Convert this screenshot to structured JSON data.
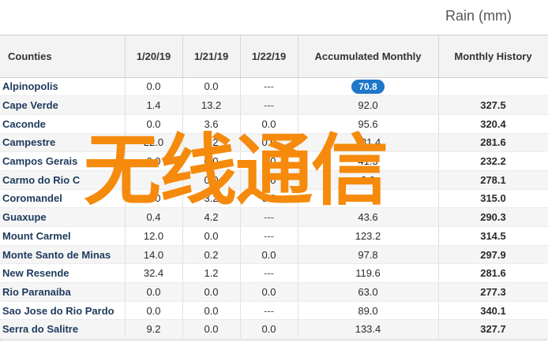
{
  "header": {
    "unit_label": "Rain (mm)"
  },
  "columns": {
    "county": "Counties",
    "d1": "1/20/19",
    "d2": "1/21/19",
    "d3": "1/22/19",
    "accumulated": "Accumulated Monthly",
    "history": "Monthly History"
  },
  "rows": [
    {
      "county": "Alpinopolis",
      "d1": "0.0",
      "d2": "0.0",
      "d3": "---",
      "acc": "70.8",
      "hist": "",
      "highlight": true
    },
    {
      "county": "Cape Verde",
      "d1": "1.4",
      "d2": "13.2",
      "d3": "---",
      "acc": "92.0",
      "hist": "327.5"
    },
    {
      "county": "Caconde",
      "d1": "0.0",
      "d2": "3.6",
      "d3": "0.0",
      "acc": "95.6",
      "hist": "320.4"
    },
    {
      "county": "Campestre",
      "d1": "22.0",
      "d2": "0.2",
      "d3": "0.0",
      "acc": "131.4",
      "hist": "281.6"
    },
    {
      "county": "Campos Gerais",
      "d1": "0.0",
      "d2": "0.0",
      "d3": "0.0",
      "acc": "41.3",
      "hist": "232.2"
    },
    {
      "county": "Carmo do Rio C",
      "d1": "",
      "d2": "0.0",
      "d3": "0.0",
      "acc": "3.0",
      "hist": "278.1"
    },
    {
      "county": "Coromandel",
      "d1": "0.0",
      "d2": "3.2",
      "d3": "0.0",
      "acc": "8.8",
      "hist": "315.0"
    },
    {
      "county": "Guaxupe",
      "d1": "0.4",
      "d2": "4.2",
      "d3": "---",
      "acc": "43.6",
      "hist": "290.3"
    },
    {
      "county": "Mount Carmel",
      "d1": "12.0",
      "d2": "0.0",
      "d3": "---",
      "acc": "123.2",
      "hist": "314.5"
    },
    {
      "county": "Monte Santo de Minas",
      "d1": "14.0",
      "d2": "0.2",
      "d3": "0.0",
      "acc": "97.8",
      "hist": "297.9"
    },
    {
      "county": "New Resende",
      "d1": "32.4",
      "d2": "1.2",
      "d3": "---",
      "acc": "119.6",
      "hist": "281.6"
    },
    {
      "county": "Rio Paranaíba",
      "d1": "0.0",
      "d2": "0.0",
      "d3": "0.0",
      "acc": "63.0",
      "hist": "277.3"
    },
    {
      "county": "Sao Jose do Rio Pardo",
      "d1": "0.0",
      "d2": "0.0",
      "d3": "---",
      "acc": "89.0",
      "hist": "340.1"
    },
    {
      "county": "Serra do Salitre",
      "d1": "9.2",
      "d2": "0.0",
      "d3": "0.0",
      "acc": "133.4",
      "hist": "327.7"
    }
  ],
  "watermark": {
    "text": "无线通信",
    "color": "#f58a0c"
  },
  "colors": {
    "badge": "#1e77c9",
    "county_text": "#1e3a5c"
  }
}
